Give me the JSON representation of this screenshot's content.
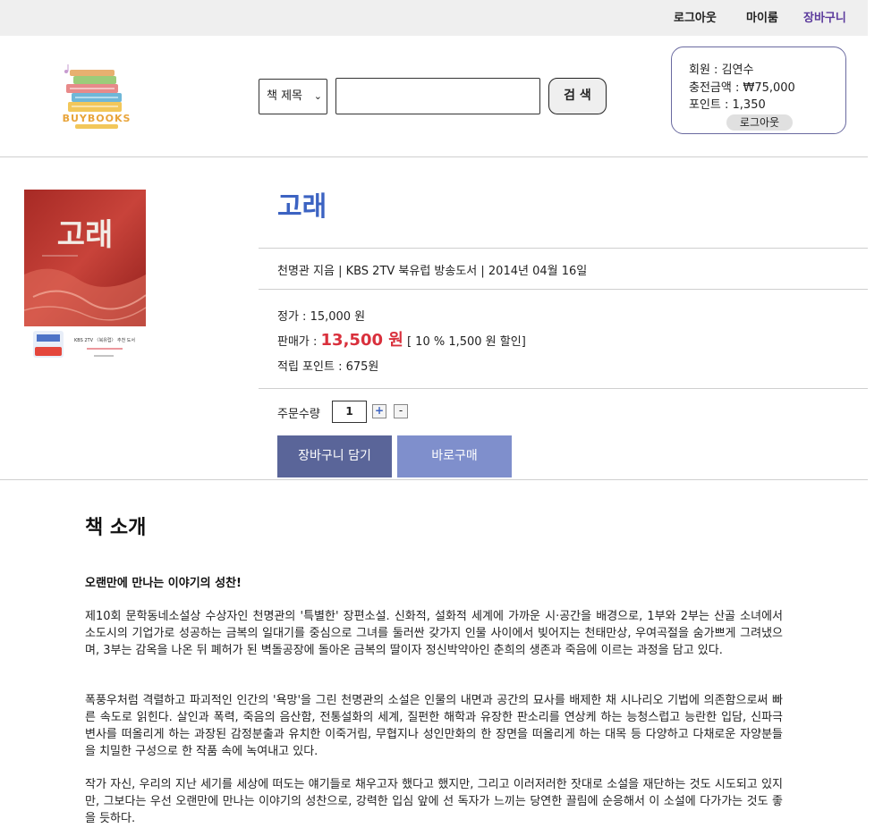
{
  "topbar": {
    "logout": "로그아웃",
    "mypage": "마이룸",
    "cart": "장바구니"
  },
  "logo": {
    "brand": "BUYBOOKS"
  },
  "search": {
    "category": "책 제목",
    "button": "검 색"
  },
  "member": {
    "name_line": "회원 : 김연수",
    "charge_line": "충전금액 : ₩75,000",
    "point_line": "포인트 : 1,350",
    "logout": "로그아웃"
  },
  "book": {
    "cover_title": "고래",
    "cover_badge": "KBS 2TV 〈북유럽〉 추천 도서",
    "title": "고래",
    "meta": "천명관 지음 | KBS 2TV 북유럽 방송도서 | 2014년 04월 16일",
    "list_price": "정가 : 15,000 원",
    "sale_label": "판매가 : ",
    "sale_price": "13,500 원",
    "discount": "[ 10 % 1,500 원 할인]",
    "points": "적립 포인트 : 675원",
    "qty_label": "주문수량",
    "qty_value": "1",
    "qty_plus": "+",
    "qty_minus": "-",
    "add_cart": "장바구니 담기",
    "buy_now": "바로구매"
  },
  "intro": {
    "heading": "책 소개",
    "subtitle": "오랜만에 만나는 이야기의 성찬!",
    "p1": "제10회 문학동네소설상 수상자인 천명관의 '특별한' 장편소설. 신화적, 설화적 세계에 가까운 시·공간을 배경으로, 1부와 2부는 산골 소녀에서 소도시의 기업가로 성공하는 금복의 일대기를 중심으로 그녀를 둘러싼 갖가지 인물 사이에서 빚어지는 천태만상, 우여곡절을 숨가쁘게 그려냈으며, 3부는 감옥을 나온 뒤 폐허가 된 벽돌공장에 돌아온 금복의 딸이자 정신박약아인 춘희의 생존과 죽음에 이르는 과정을 담고 있다.",
    "p2": "폭풍우처럼 격렬하고 파괴적인 인간의 '욕망'을 그린 천명관의 소설은 인물의 내면과 공간의 묘사를 배제한 채 시나리오 기법에 의존함으로써 빠른 속도로 읽힌다. 살인과 폭력, 죽음의 음산함, 전통설화의 세계, 질펀한 해학과 유장한 판소리를 연상케 하는 능청스럽고 능란한 입담, 신파극 변사를 떠올리게 하는 과장된 감정분출과 유치한 이죽거림, 무협지나 성인만화의 한 장면을 떠올리게 하는 대목 등 다양하고 다채로운 자양분들을 치밀한 구성으로 한 작품 속에 녹여내고 있다.",
    "p3": "작가 자신, 우리의 지난 세기를 세상에 떠도는 얘기들로 채우고자 했다고 했지만, 그리고 이러저러한 잣대로 소설을 재단하는 것도 시도되고 있지만, 그보다는 우선 오랜만에 만나는 이야기의 성찬으로, 강력한 입심 앞에 선 독자가 느끼는 당연한 끌림에 순응해서 이 소설에 다가가는 것도 좋을 듯하다."
  },
  "colors": {
    "title": "#3c63c2",
    "sale": "#d9303c",
    "cart_btn": "#5a6599",
    "buy_btn": "#7f8fcc"
  }
}
